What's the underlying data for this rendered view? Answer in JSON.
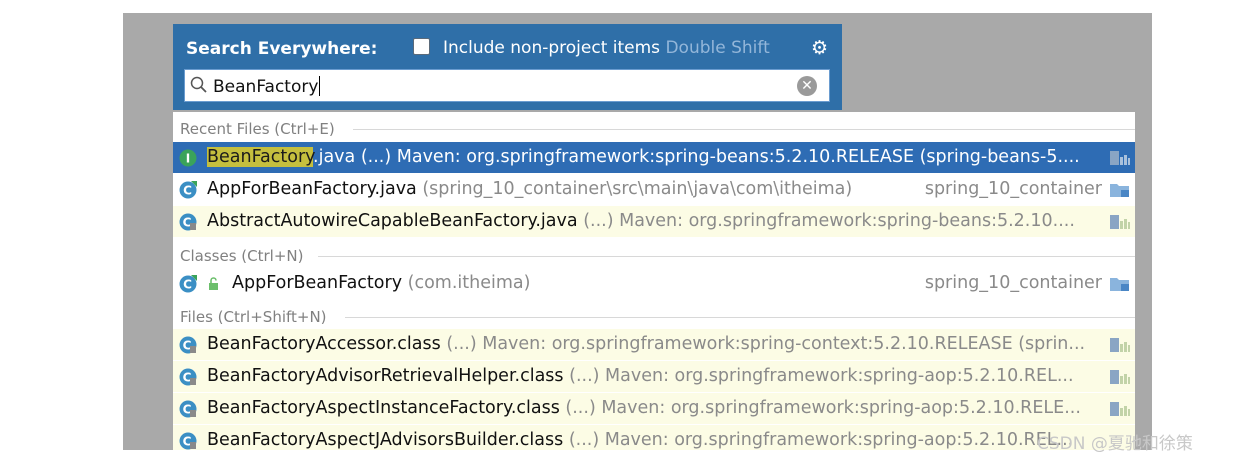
{
  "search": {
    "title": "Search Everywhere:",
    "include_label": "Include non-project items",
    "include_shortcut": "Double Shift",
    "include_checked": false,
    "query": "BeanFactory",
    "gear_icon": "gear-icon",
    "clear_icon": "clear-icon"
  },
  "sections": {
    "recent": "Recent Files (Ctrl+E)",
    "classes": "Classes (Ctrl+N)",
    "files": "Files (Ctrl+Shift+N)"
  },
  "rows": {
    "r1": {
      "match": "BeanFactory",
      "name_rest": ".java",
      "loc": "(...)  Maven: org.springframework:spring-beans:5.2.10.RELEASE (spring-beans-5....",
      "selected": true
    },
    "r2": {
      "name": "AppForBeanFactory.java",
      "loc": "(spring_10_container\\src\\main\\java\\com\\itheima)",
      "module": "spring_10_container"
    },
    "r3": {
      "name": "AbstractAutowireCapableBeanFactory.java",
      "loc": "(...)  Maven: org.springframework:spring-beans:5.2.10...."
    },
    "c1": {
      "name": "AppForBeanFactory",
      "loc": "(com.itheima)",
      "module": "spring_10_container"
    },
    "f1": {
      "name": "BeanFactoryAccessor.class",
      "loc": "(...)  Maven: org.springframework:spring-context:5.2.10.RELEASE (sprin..."
    },
    "f2": {
      "name": "BeanFactoryAdvisorRetrievalHelper.class",
      "loc": "(...)  Maven: org.springframework:spring-aop:5.2.10.REL..."
    },
    "f3": {
      "name": "BeanFactoryAspectInstanceFactory.class",
      "loc": "(...)  Maven: org.springframework:spring-aop:5.2.10.RELE..."
    },
    "f4": {
      "name": "BeanFactoryAspectJAdvisorsBuilder.class",
      "loc": "(...)  Maven: org.springframework:spring-aop:5.2.10.REL..."
    }
  },
  "watermark": "CSDN @夏驰和徐策",
  "colors": {
    "header_bg": "#2f6fa8",
    "selected_bg": "#2e6cb4",
    "library_row_bg": "#fcfce5",
    "class_icon": "#3b8fc4",
    "interface_icon": "#3aa35a"
  }
}
